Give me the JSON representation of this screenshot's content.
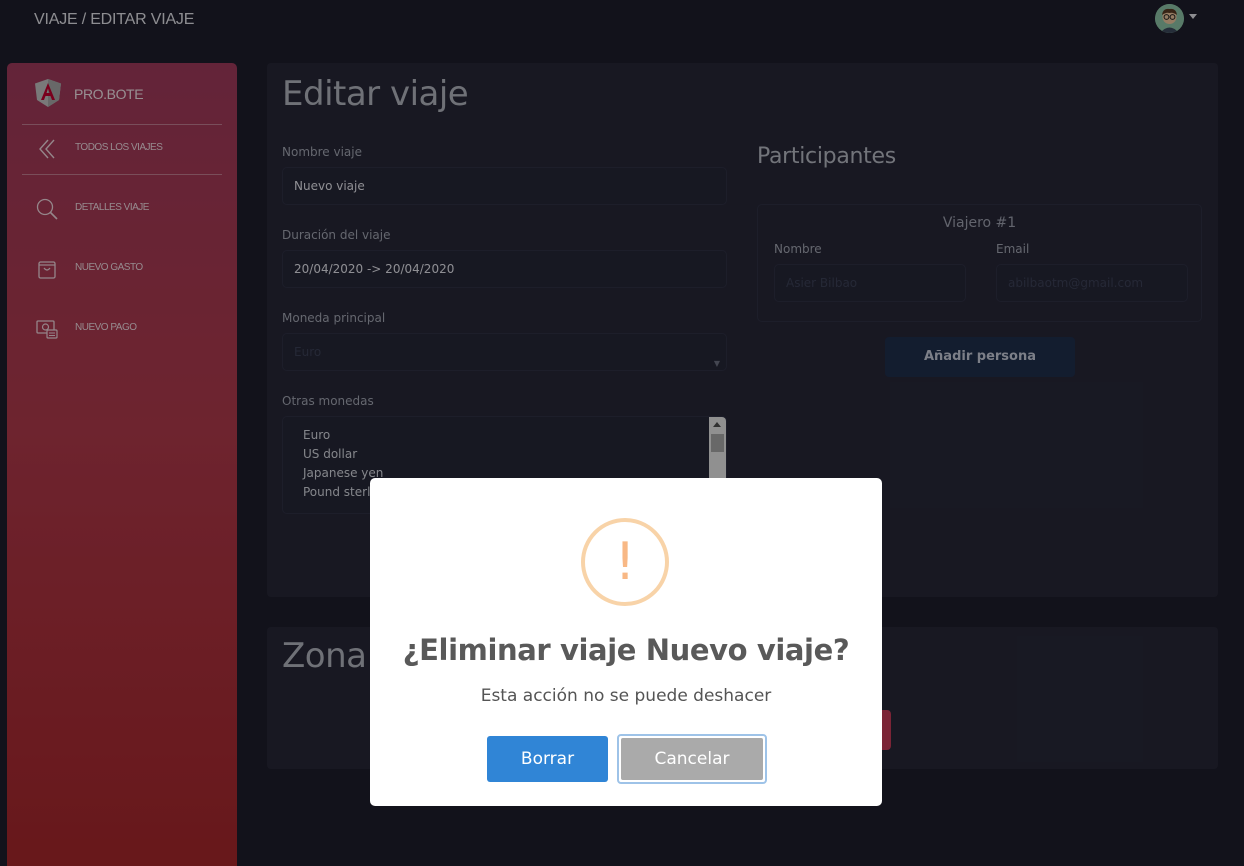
{
  "header": {
    "breadcrumb": "VIAJE / EDITAR VIAJE",
    "avatar": "user-avatar-icon"
  },
  "sidebar": {
    "brand": "PRO.BOTE",
    "items": [
      {
        "label": "TODOS LOS VIAJES",
        "icon": "double-chevron-left-icon"
      },
      {
        "label": "DETALLES VIAJE",
        "icon": "search-icon"
      },
      {
        "label": "NUEVO GASTO",
        "icon": "shopping-bag-icon"
      },
      {
        "label": "NUEVO PAGO",
        "icon": "payment-icon"
      }
    ]
  },
  "edit": {
    "title": "Editar viaje",
    "name_label": "Nombre viaje",
    "name_value": "Nuevo viaje",
    "duration_label": "Duración del viaje",
    "duration_value": "20/04/2020 -> 20/04/2020",
    "currency_label": "Moneda principal",
    "currency_value": "Euro",
    "other_label": "Otras monedas",
    "other_options": [
      "Euro",
      "US dollar",
      "Japanese yen",
      "Pound sterl"
    ]
  },
  "participants": {
    "title": "Participantes",
    "traveler_title": "Viajero #1",
    "name_label": "Nombre",
    "email_label": "Email",
    "name_placeholder": "Asier Bilbao",
    "email_placeholder": "abilbaotm@gmail.com",
    "add_button": "Añadir persona"
  },
  "danger": {
    "title": "Zona"
  },
  "dialog": {
    "icon": "warning-icon",
    "mark": "!",
    "title": "¿Eliminar viaje Nuevo viaje?",
    "text": "Esta acción no se puede deshacer",
    "confirm": "Borrar",
    "cancel": "Cancelar"
  },
  "colors": {
    "background": "#1e1e2c",
    "card": "#272838",
    "sidebar_top": "#a13a5d",
    "sidebar_bottom": "#a8262a",
    "confirm_button": "#3085d6",
    "cancel_button": "#aaaaaa",
    "warning": "#f8b885"
  }
}
